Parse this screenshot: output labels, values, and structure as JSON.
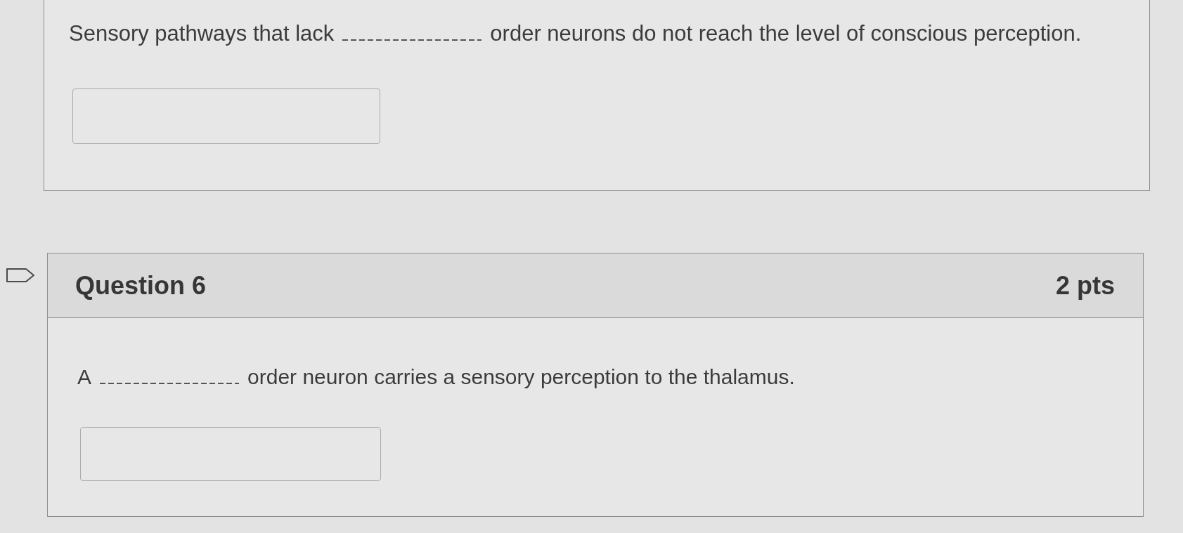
{
  "previous_question": {
    "prompt": [
      {
        "kind": "text",
        "text": "Sensory pathways that lack"
      },
      {
        "kind": "blank"
      },
      {
        "kind": "text",
        "text": "order neurons do not reach the level of conscious perception."
      }
    ]
  },
  "question": {
    "flagged": false,
    "title": "Question 6",
    "points": "2 pts",
    "prompt": [
      {
        "kind": "text",
        "text": "A"
      },
      {
        "kind": "blank"
      },
      {
        "kind": "text",
        "text": "order neuron carries a sensory perception to the thalamus."
      }
    ]
  }
}
